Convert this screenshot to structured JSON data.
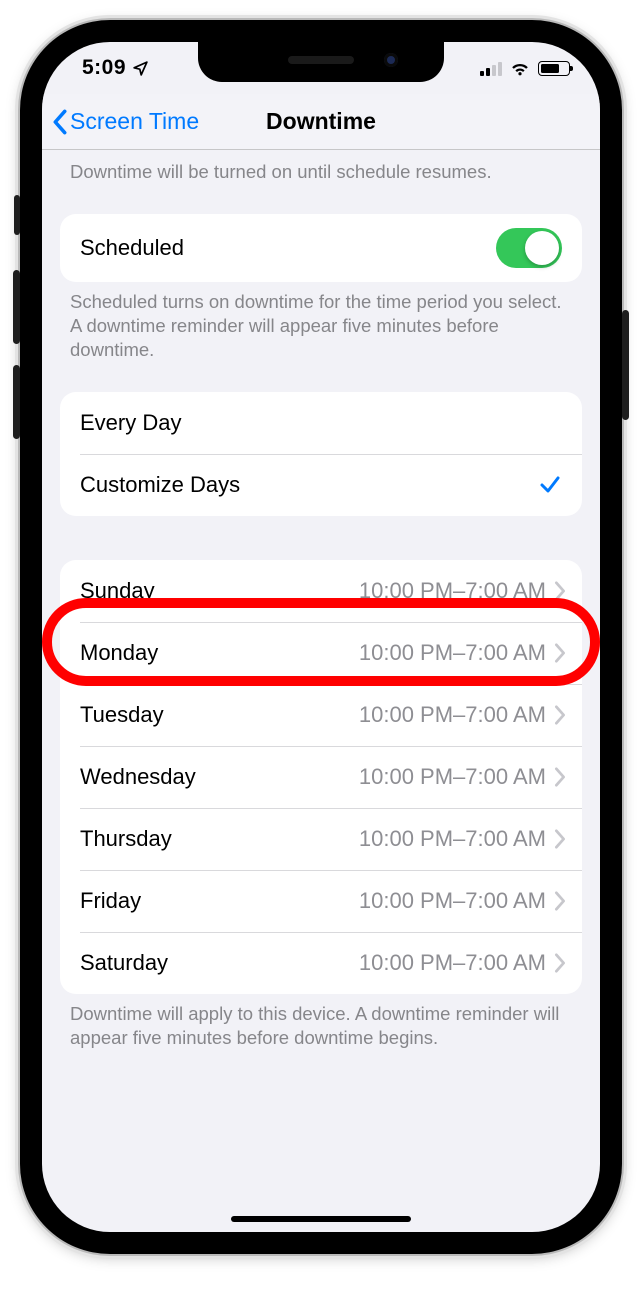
{
  "status": {
    "time": "5:09"
  },
  "nav": {
    "back": "Screen Time",
    "title": "Downtime"
  },
  "section1": {
    "footer_top": "Downtime will be turned on until schedule resumes."
  },
  "scheduled": {
    "label": "Scheduled",
    "footer": "Scheduled turns on downtime for the time period you select. A downtime reminder will appear five minutes before downtime."
  },
  "mode": {
    "every_day": "Every Day",
    "customize": "Customize Days"
  },
  "days": [
    {
      "name": "Sunday",
      "range": "10:00 PM–7:00 AM"
    },
    {
      "name": "Monday",
      "range": "10:00 PM–7:00 AM"
    },
    {
      "name": "Tuesday",
      "range": "10:00 PM–7:00 AM"
    },
    {
      "name": "Wednesday",
      "range": "10:00 PM–7:00 AM"
    },
    {
      "name": "Thursday",
      "range": "10:00 PM–7:00 AM"
    },
    {
      "name": "Friday",
      "range": "10:00 PM–7:00 AM"
    },
    {
      "name": "Saturday",
      "range": "10:00 PM–7:00 AM"
    }
  ],
  "days_footer": "Downtime will apply to this device. A downtime reminder will appear five minutes before downtime begins."
}
